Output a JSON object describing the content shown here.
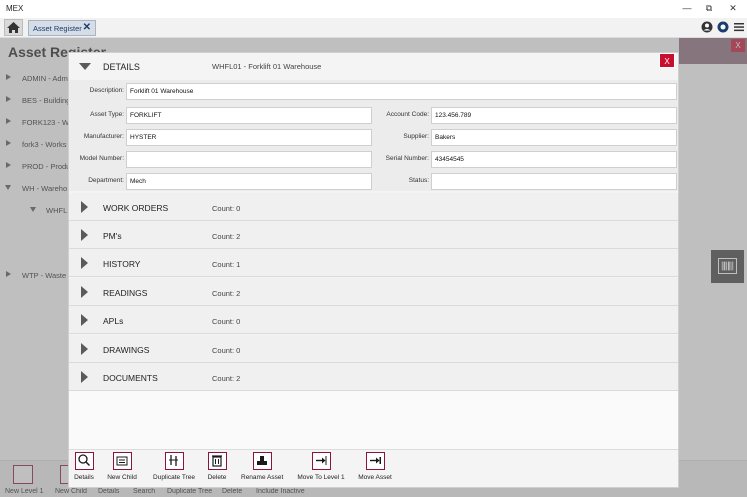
{
  "window": {
    "app_title": "MEX",
    "minimize": "—",
    "restore": "⧉",
    "close": "✕"
  },
  "tabs": [
    {
      "label": "Asset Register",
      "close": "✕"
    }
  ],
  "page": {
    "title": "Asset Register",
    "close": "X",
    "tree": [
      {
        "label": "ADMIN - Admi",
        "expanded": false
      },
      {
        "label": "BES - Building",
        "expanded": false
      },
      {
        "label": "FORK123 - W",
        "expanded": false
      },
      {
        "label": "fork3 - Works",
        "expanded": false
      },
      {
        "label": "PROD - Produ",
        "expanded": false
      },
      {
        "label": "WH - Wareho",
        "expanded": true
      },
      {
        "label": "WHFL",
        "expanded": true,
        "child": true
      },
      {
        "label": "WTP - Waste",
        "expanded": false
      }
    ]
  },
  "bottom_bar": {
    "labels": [
      "New Level 1",
      "New Child",
      "Details",
      "Search",
      "Duplicate Tree",
      "Delete",
      "Include Inactive"
    ]
  },
  "modal": {
    "close": "X",
    "details_title": "DETAILS",
    "asset_subtitle": "WHFL01 - Forklift 01 Warehouse",
    "fields": {
      "description": {
        "label": "Description:",
        "value": "Forklift 01 Warehouse"
      },
      "asset_type": {
        "label": "Asset Type:",
        "value": "FORKLIFT"
      },
      "account_code": {
        "label": "Account Code:",
        "value": "123.456.789"
      },
      "manufacturer": {
        "label": "Manufacturer:",
        "value": "HYSTER"
      },
      "supplier": {
        "label": "Supplier:",
        "value": "Bakers"
      },
      "model_number": {
        "label": "Model Number:",
        "value": ""
      },
      "serial_number": {
        "label": "Serial Number:",
        "value": "43454545"
      },
      "department": {
        "label": "Department:",
        "value": "Mech"
      },
      "status": {
        "label": "Status:",
        "value": ""
      }
    },
    "sections": [
      {
        "title": "WORK ORDERS",
        "count": "Count: 0"
      },
      {
        "title": "PM's",
        "count": "Count: 2"
      },
      {
        "title": "HISTORY",
        "count": "Count: 1"
      },
      {
        "title": "READINGS",
        "count": "Count: 2"
      },
      {
        "title": "APLs",
        "count": "Count: 0"
      },
      {
        "title": "DRAWINGS",
        "count": "Count: 0"
      },
      {
        "title": "DOCUMENTS",
        "count": "Count: 2"
      }
    ],
    "toolbar": [
      {
        "label": "Details",
        "icon": "magnifier-icon"
      },
      {
        "label": "New Child",
        "icon": "new-child-icon"
      },
      {
        "label": "Duplicate Tree",
        "icon": "duplicate-tree-icon"
      },
      {
        "label": "Delete",
        "icon": "trash-icon"
      },
      {
        "label": "Rename Asset",
        "icon": "rename-icon"
      },
      {
        "label": "Move To Level 1",
        "icon": "move-level1-icon"
      },
      {
        "label": "Move Asset",
        "icon": "move-asset-icon"
      }
    ]
  },
  "colors": {
    "accent": "#8a1538",
    "close_red": "#c8102e",
    "tab_text": "#1a3d6d"
  }
}
